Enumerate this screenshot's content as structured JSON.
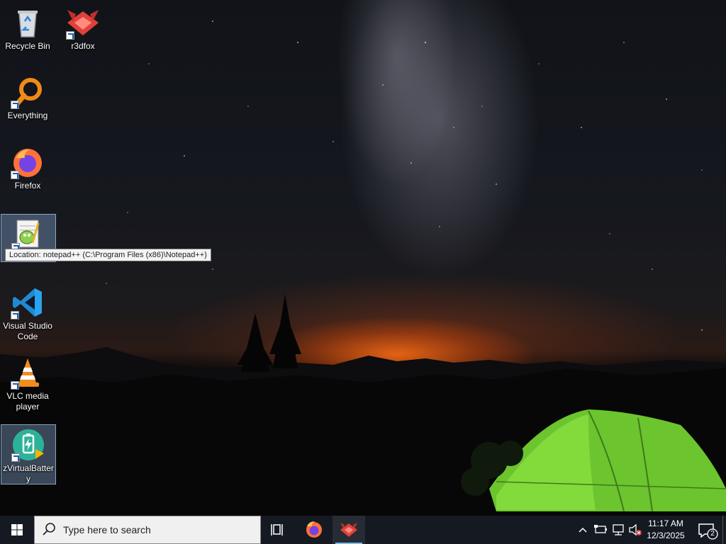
{
  "desktop": {
    "icons": [
      {
        "label": "Recycle Bin",
        "icon": "recycle-bin-icon"
      },
      {
        "label": "r3dfox",
        "icon": "r3dfox-icon"
      },
      {
        "label": "Everything",
        "icon": "everything-search-icon"
      },
      {
        "label": "Firefox",
        "icon": "firefox-icon"
      },
      {
        "label": "",
        "icon": "notepad-plus-plus-icon"
      },
      {
        "label": "Visual Studio Code",
        "icon": "vscode-icon"
      },
      {
        "label": "VLC media player",
        "icon": "vlc-icon"
      },
      {
        "label": "zVirtualBattery",
        "icon": "zvirtualbattery-icon"
      }
    ],
    "tooltip": "Location: notepad++ (C:\\Program Files (x86)\\Notepad++)"
  },
  "taskbar": {
    "start_icon": "windows-logo-icon",
    "search": {
      "placeholder": "Type here to search",
      "icon": "search-icon"
    },
    "task_view_icon": "task-view-icon",
    "apps": [
      {
        "name": "Firefox",
        "icon": "firefox-icon",
        "active": false
      },
      {
        "name": "r3dfox",
        "icon": "r3dfox-icon",
        "active": true
      }
    ],
    "tray": {
      "icons": [
        "chevron-up-icon",
        "battery-icon",
        "network-icon",
        "volume-muted-icon"
      ],
      "time": "11:17 AM",
      "date": "12/3/2025",
      "notification_count": "2"
    }
  },
  "colors": {
    "taskbar": "#151a22",
    "accent": "#76b9ed",
    "tent": "#7fd63a"
  }
}
